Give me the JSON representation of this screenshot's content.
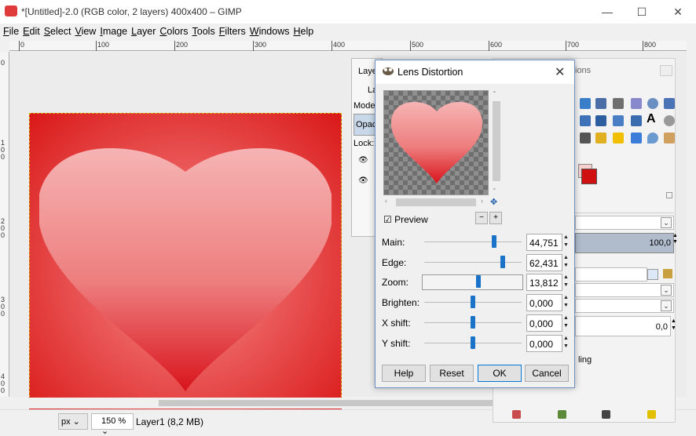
{
  "window": {
    "title": "*[Untitled]-2.0 (RGB color, 2 layers) 400x400 – GIMP",
    "min_glyph": "—",
    "max_glyph": "☐",
    "close_glyph": "✕"
  },
  "menu": [
    "File",
    "Edit",
    "Select",
    "View",
    "Image",
    "Layer",
    "Colors",
    "Tools",
    "Filters",
    "Windows",
    "Help"
  ],
  "ruler": {
    "h_ticks": [
      "0",
      "100",
      "200",
      "300",
      "400",
      "500",
      "600",
      "700",
      "800"
    ],
    "v_ticks": [
      "0",
      "100",
      "200",
      "300",
      "400"
    ]
  },
  "status": {
    "unit": "px",
    "zoom": "150 %",
    "layer_info": "Layer1 (8,2 MB)"
  },
  "layers_panel": {
    "tab": "Laye",
    "row1": "La",
    "mode": "Mode:",
    "opacity": "Opaci",
    "lock": "Lock:"
  },
  "right_dock": {
    "tab": "ions",
    "opacity_value": "100,0",
    "field_value": "0,0",
    "label_ling": "ling"
  },
  "dialog": {
    "title": "Lens Distortion",
    "preview_label": "Preview",
    "params": [
      {
        "label": "Main:",
        "value": "44,751",
        "fraction": 0.72
      },
      {
        "label": "Edge:",
        "value": "62,431",
        "fraction": 0.81
      },
      {
        "label": "Zoom:",
        "value": "13,812",
        "fraction": 0.56
      },
      {
        "label": "Brighten:",
        "value": "0,000",
        "fraction": 0.5
      },
      {
        "label": "X shift:",
        "value": "0,000",
        "fraction": 0.5
      },
      {
        "label": "Y shift:",
        "value": "0,000",
        "fraction": 0.5
      }
    ],
    "buttons": {
      "help": "Help",
      "reset": "Reset",
      "ok": "OK",
      "cancel": "Cancel"
    }
  },
  "colors": {
    "accent": "#1a73c8",
    "heart_top": "#f6b4b4",
    "heart_bottom": "#d8141c",
    "canvas_edge": "#d91818"
  }
}
